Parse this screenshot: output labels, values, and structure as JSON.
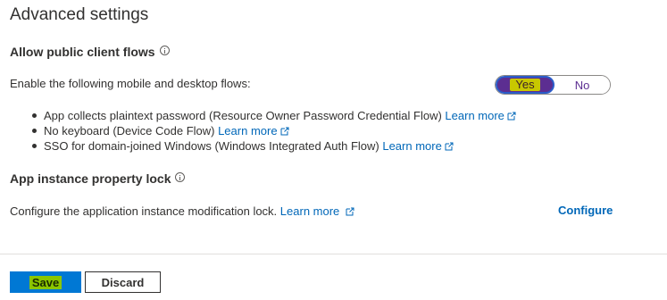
{
  "section": {
    "title": "Advanced settings"
  },
  "public_client": {
    "heading": "Allow public client flows",
    "label": "Enable the following mobile and desktop flows:",
    "toggle": {
      "yes_label": "Yes",
      "no_label": "No",
      "selected": "Yes"
    },
    "bullets": [
      {
        "text": "App collects plaintext password (Resource Owner Password Credential Flow) ",
        "link": "Learn more"
      },
      {
        "text": "No keyboard (Device Code Flow) ",
        "link": "Learn more"
      },
      {
        "text": "SSO for domain-joined Windows (Windows Integrated Auth Flow) ",
        "link": "Learn more"
      }
    ]
  },
  "instance_lock": {
    "heading": "App instance property lock",
    "label": "Configure the application instance modification lock. ",
    "link": "Learn more",
    "configure_label": "Configure"
  },
  "footer": {
    "save_label": "Save",
    "discard_label": "Discard"
  },
  "colors": {
    "link": "#0067b8",
    "primary_button": "#0078d4",
    "toggle_selected": "#5c2e91"
  }
}
